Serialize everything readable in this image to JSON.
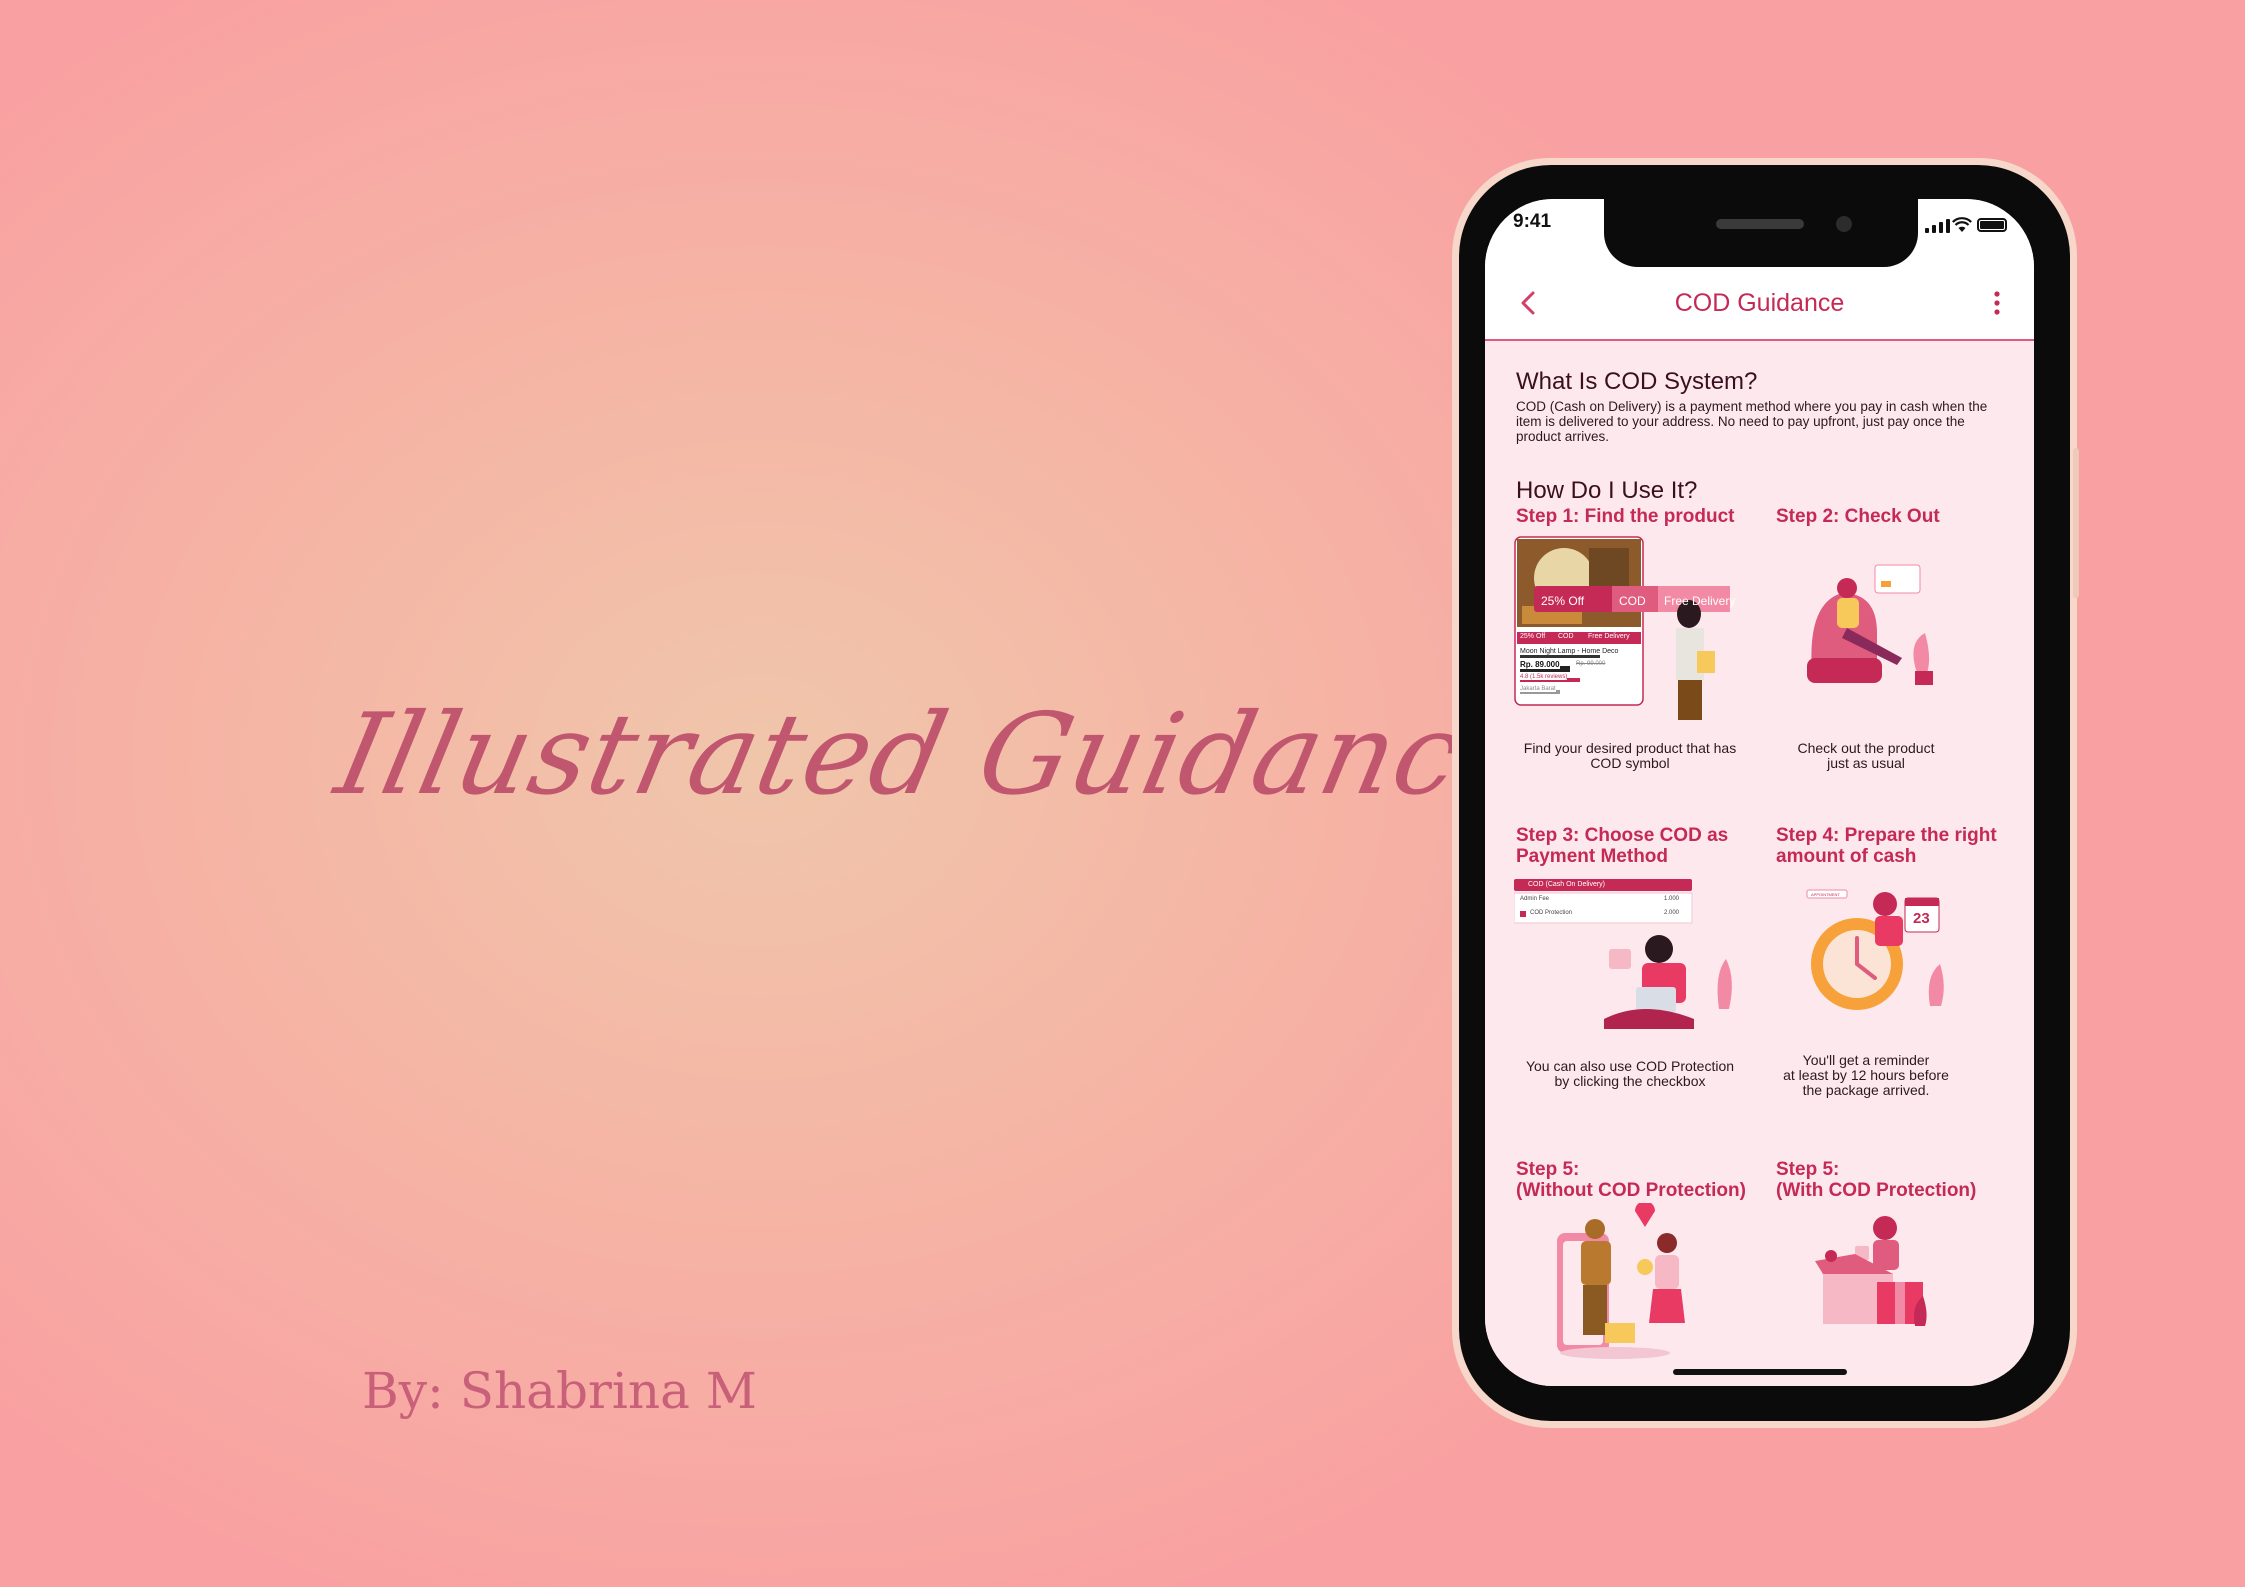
{
  "headline": "Illustrated Guidance",
  "byline": "By: Shabrina M",
  "status_bar": {
    "time": "9:41"
  },
  "app_bar": {
    "title": "COD Guidance"
  },
  "intro": {
    "heading": "What Is COD System?",
    "body": "COD (Cash on Delivery) is a payment method where you pay in cash when the item is delivered to your address. No need to pay upfront, just pay once the product arrives."
  },
  "how_to": {
    "heading": "How Do I Use It?",
    "steps": [
      {
        "title": "Step 1: Find the product",
        "caption": "Find your desired product that has\nCOD symbol"
      },
      {
        "title": "Step 2: Check Out",
        "caption": "Check out the product\njust as usual"
      },
      {
        "title": "Step 3: Choose COD as\nPayment Method",
        "caption": "You can also use COD Protection\nby clicking the checkbox"
      },
      {
        "title": "Step 4: Prepare the right\namount of cash",
        "caption": "You'll get a reminder\nat least by 12 hours before\nthe package arrived."
      },
      {
        "title": "Step 5:\n(Without COD Protection)",
        "caption": ""
      },
      {
        "title": "Step 5:\n(With COD Protection)",
        "caption": ""
      }
    ]
  },
  "product_card": {
    "badges": [
      "25% Off",
      "COD",
      "Free Delivery"
    ],
    "small_badges": [
      "25% Off",
      "COD",
      "Free Delivery"
    ],
    "name": "Moon Night Lamp - Home Deco",
    "price": "Rp. 89.000",
    "old_price": "Rp. 99.000",
    "rating": "4.8 (1.5k reviews)",
    "location": "Jakarta Barat"
  },
  "payment_card": {
    "option": "COD (Cash On Delivery)",
    "admin_fee": "Admin Fee",
    "protection": "COD Protection",
    "amount1": "1.000",
    "amount2": "2.000"
  },
  "calendar": {
    "day": "23",
    "banner": "APPOINTMENT"
  },
  "colors": {
    "accent": "#c42a55",
    "screen_bg": "#fde9ed",
    "headline": "#c1566f"
  },
  "icons": [
    "back-chevron-icon",
    "more-vertical-icon",
    "wifi-icon",
    "battery-icon",
    "signal-icon"
  ]
}
